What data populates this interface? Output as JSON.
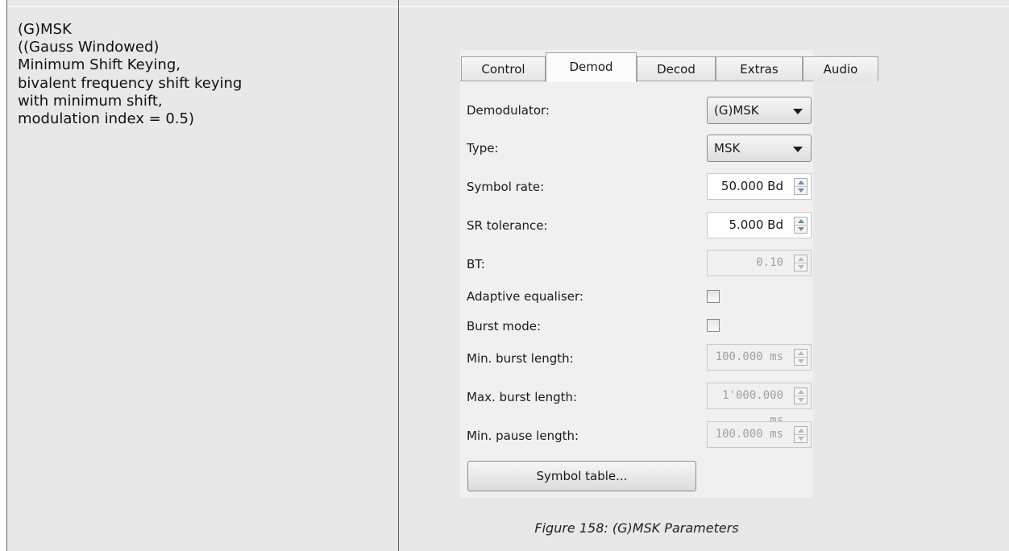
{
  "description": {
    "lines": [
      "(G)MSK",
      "((Gauss Windowed)",
      "Minimum Shift Keying,",
      "bivalent frequency shift keying",
      "with minimum shift,",
      "modulation index = 0.5)"
    ]
  },
  "dialog": {
    "tabs": [
      {
        "label": "Control",
        "active": false
      },
      {
        "label": "Demod",
        "active": true
      },
      {
        "label": "Decod",
        "active": false
      },
      {
        "label": "Extras",
        "active": false
      },
      {
        "label": "Audio",
        "active": false
      }
    ],
    "demodulator": {
      "label": "Demodulator:",
      "value": "(G)MSK"
    },
    "type": {
      "label": "Type:",
      "value": "MSK"
    },
    "symbol_rate": {
      "label": "Symbol rate:",
      "value": "50.000 Bd"
    },
    "sr_tolerance": {
      "label": "SR tolerance:",
      "value": "5.000 Bd"
    },
    "bt": {
      "label": "BT:",
      "value": "0.10"
    },
    "adaptive_equaliser": {
      "label": "Adaptive equaliser:",
      "checked": false
    },
    "burst_mode": {
      "label": "Burst mode:",
      "checked": false
    },
    "min_burst_length": {
      "label": "Min. burst length:",
      "value": "100.000 ms"
    },
    "max_burst_length": {
      "label": "Max. burst length:",
      "value": "1'000.000 ms"
    },
    "min_pause_length": {
      "label": "Min. pause length:",
      "value": "100.000 ms"
    },
    "symbol_table_button": "Symbol table..."
  },
  "caption": "Figure 158: (G)MSK Parameters"
}
